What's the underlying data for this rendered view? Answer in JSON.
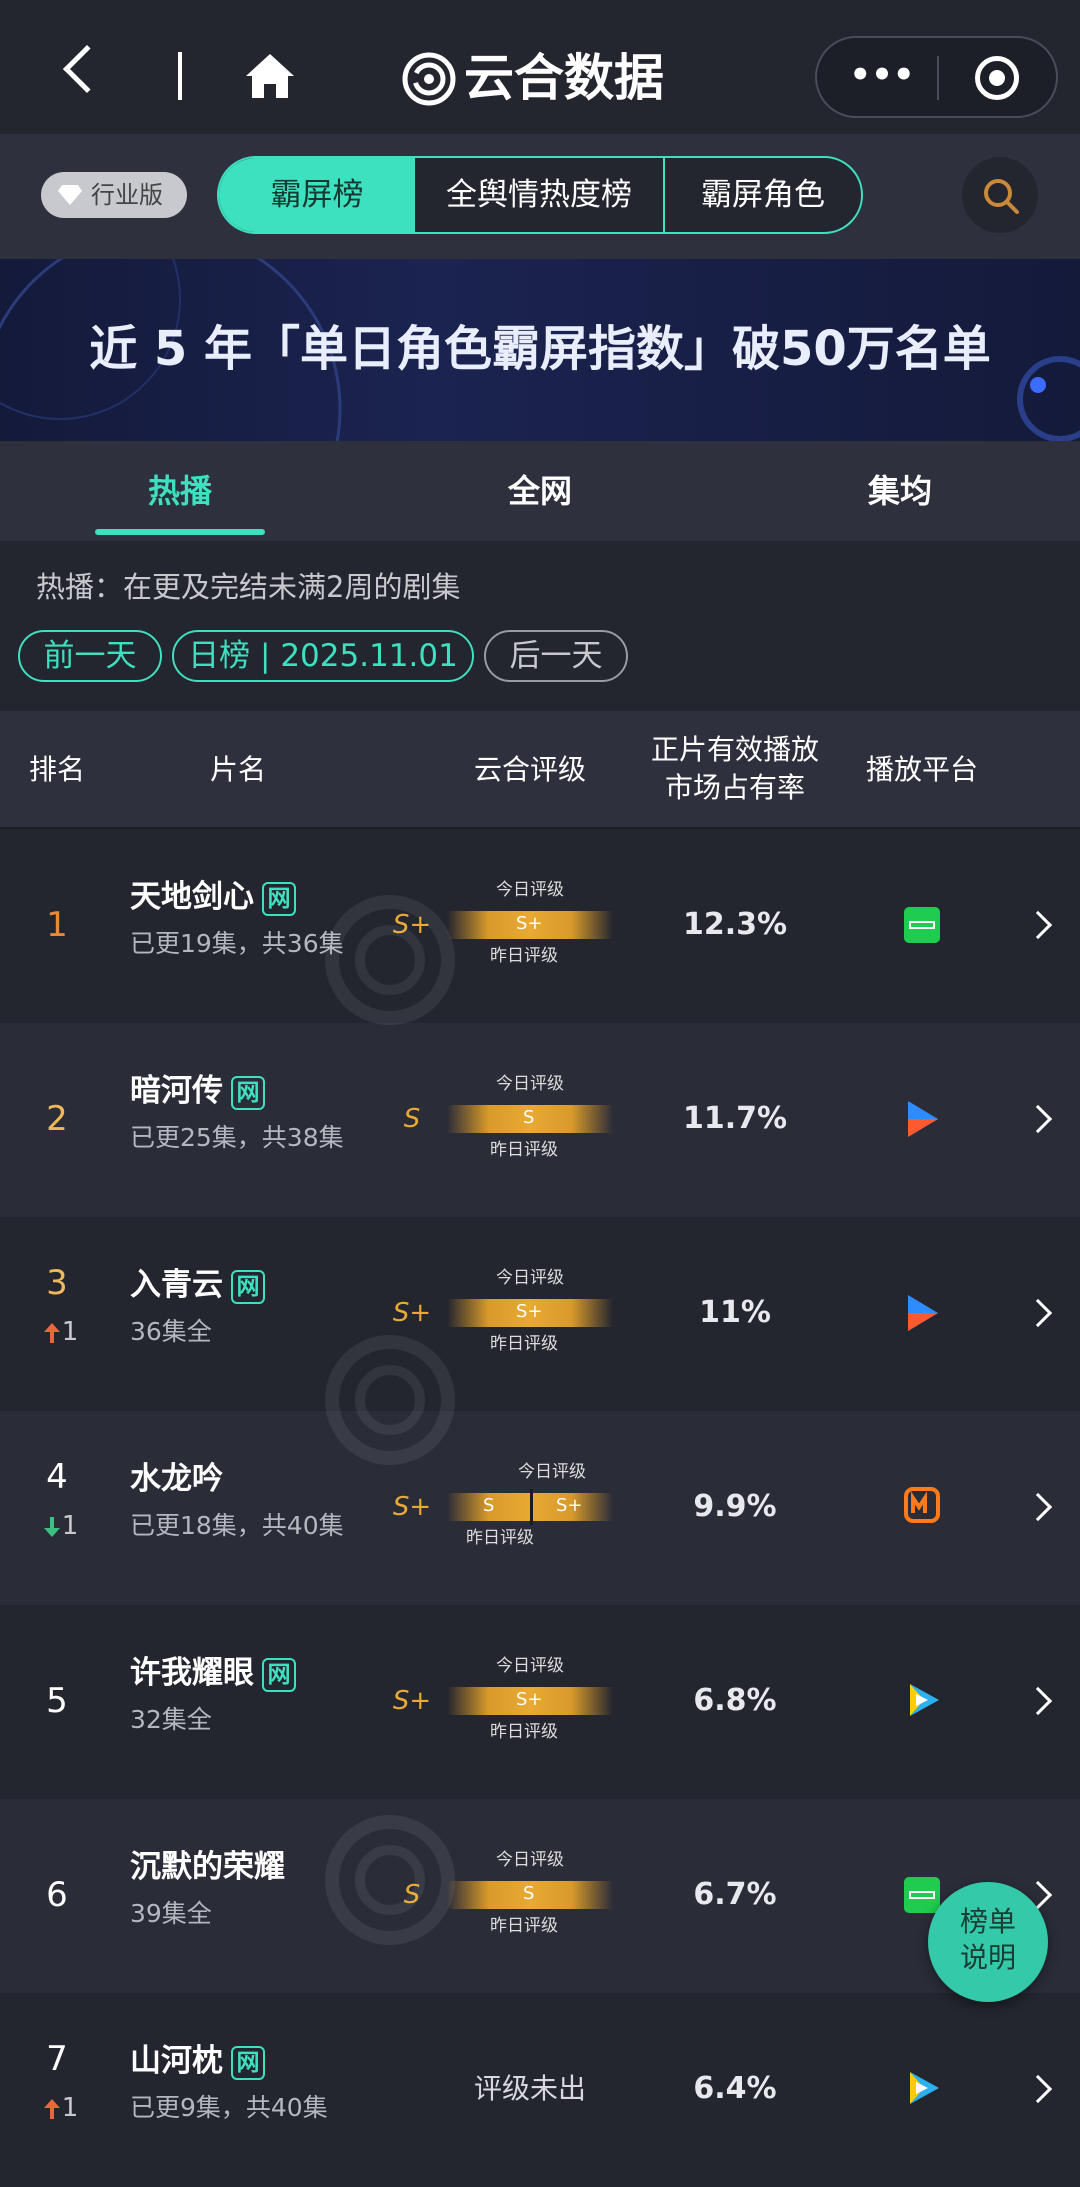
{
  "app": {
    "title": "云合数据"
  },
  "header_tabs": {
    "edition_badge": "行业版",
    "tabs": [
      "霸屏榜",
      "全舆情热度榜",
      "霸屏角色"
    ]
  },
  "banner": {
    "text": "近 5 年「单日角色霸屏指数」破50万名单"
  },
  "sub_tabs": [
    "热播",
    "全网",
    "集均"
  ],
  "filter": {
    "note": "热播：在更及完结未满2周的剧集",
    "prev_day": "前一天",
    "current": "日榜 | 2025.11.01",
    "next_day": "后一天"
  },
  "table": {
    "headers": {
      "rank": "排名",
      "title": "片名",
      "rating": "云合评级",
      "share_line1": "正片有效播放",
      "share_line2": "市场占有率",
      "platform": "播放平台"
    },
    "rating_today": "今日评级",
    "rating_yesterday": "昨日评级",
    "net_tag": "网",
    "rows": [
      {
        "rank": "1",
        "change": "",
        "title": "天地剑心",
        "episodes": "已更19集，共36集",
        "grade": "S+",
        "today": "S+",
        "yesterday": "",
        "share": "12.3%",
        "platform": "iqiyi"
      },
      {
        "rank": "2",
        "change": "",
        "title": "暗河传",
        "episodes": "已更25集，共38集",
        "grade": "S",
        "today": "S",
        "yesterday": "",
        "share": "11.7%",
        "platform": "youku"
      },
      {
        "rank": "3",
        "change": "1",
        "title": "入青云",
        "episodes": "36集全",
        "grade": "S+",
        "today": "S+",
        "yesterday": "",
        "share": "11%",
        "platform": "youku"
      },
      {
        "rank": "4",
        "change": "1",
        "title": "水龙吟",
        "episodes": "已更18集，共40集",
        "grade": "S+",
        "today": "S+",
        "yesterday": "S",
        "share": "9.9%",
        "platform": "mango"
      },
      {
        "rank": "5",
        "change": "",
        "title": "许我耀眼",
        "episodes": "32集全",
        "grade": "S+",
        "today": "S+",
        "yesterday": "",
        "share": "6.8%",
        "platform": "tencent"
      },
      {
        "rank": "6",
        "change": "",
        "title": "沉默的荣耀",
        "episodes": "39集全",
        "grade": "S",
        "today": "S",
        "yesterday": "",
        "share": "6.7%",
        "platform": "iqiyi"
      },
      {
        "rank": "7",
        "change": "1",
        "title": "山河枕",
        "episodes": "已更9集，共40集",
        "grade": "",
        "no_rating": "评级未出",
        "share": "6.4%",
        "platform": "tencent"
      }
    ]
  },
  "fab": {
    "line1": "榜单",
    "line2": "说明"
  },
  "watermark": "云合数据 ENLIGHTENT",
  "colors": {
    "accent": "#3de0bf",
    "rank_orange": "#e8893a",
    "grade_gold": "#e8aa33",
    "up_arrow": "#e8683a",
    "down_arrow": "#3dbf7f"
  }
}
